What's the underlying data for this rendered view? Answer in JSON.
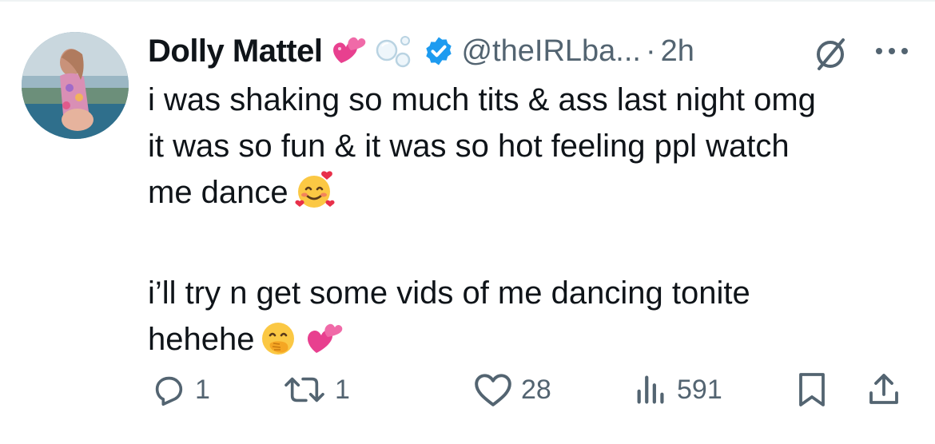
{
  "author": {
    "display_name": "Dolly Mattel",
    "handle": "@theIRLba...",
    "separator": "·",
    "time": "2h",
    "verified": true,
    "badge_icons": [
      "sparkling-heart-emoji",
      "bubbles-emoji",
      "verified-badge-icon"
    ]
  },
  "tweet": {
    "paragraph1_lines": [
      "i was shaking so much tits & ass last night omg",
      "it was so fun & it was so hot feeling ppl watch",
      "me dance"
    ],
    "paragraph2_lines": [
      "i’ll try n get some vids of me dancing tonite",
      "hehehe"
    ]
  },
  "actions": {
    "reply_count": "1",
    "retweet_count": "1",
    "like_count": "28",
    "views_count": "591"
  },
  "colors": {
    "text": "#0f1419",
    "secondary": "#536471",
    "verified": "#1d9bf0",
    "divider": "#eff3f4"
  }
}
